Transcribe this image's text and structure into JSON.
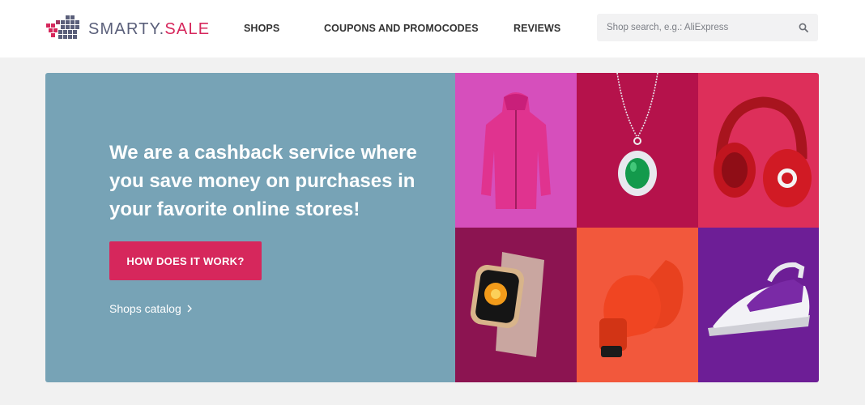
{
  "brand": {
    "name_main": "SMARTY.",
    "name_accent": "SALE",
    "colors": {
      "primary": "#5a5f7a",
      "accent": "#d6275c"
    }
  },
  "nav": {
    "shops": "SHOPS",
    "coupons": "COUPONS AND PROMOCODES",
    "reviews": "REVIEWS"
  },
  "search": {
    "placeholder": "Shop search, e.g.: AliExpress",
    "icon": "search-icon"
  },
  "hero": {
    "title": "We are a cashback service where you save money on purchases in your favorite online stores!",
    "button_label": "HOW DOES IT WORK?",
    "catalog_link": "Shops catalog",
    "background": "#77a3b6",
    "products": [
      {
        "name": "jacket",
        "bg": "#d64fbc"
      },
      {
        "name": "pendant",
        "bg": "#b5124b"
      },
      {
        "name": "headphones",
        "bg": "#dd2f5a"
      },
      {
        "name": "smartwatch",
        "bg": "#8c1451"
      },
      {
        "name": "boxing-glove",
        "bg": "#f2583c"
      },
      {
        "name": "iron",
        "bg": "#6d1e96"
      }
    ]
  }
}
